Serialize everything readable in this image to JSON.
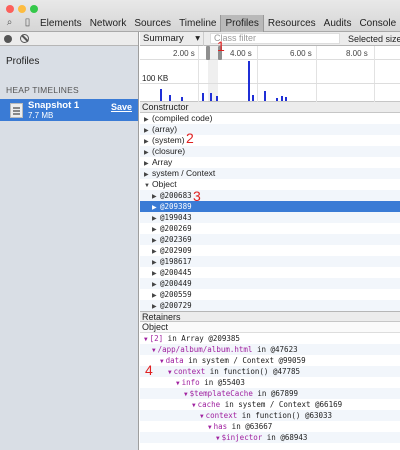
{
  "window": {
    "lights": [
      "#fc605b",
      "#fdbc40",
      "#34c84a"
    ]
  },
  "tabs": [
    "Elements",
    "Network",
    "Sources",
    "Timeline",
    "Profiles",
    "Resources",
    "Audits",
    "Console"
  ],
  "active_tab": "Profiles",
  "sidebar": {
    "title": "Profiles",
    "section": "HEAP TIMELINES",
    "snapshot": {
      "title": "Snapshot 1",
      "size": "7.7 MB",
      "save": "Save"
    }
  },
  "toolbar": {
    "view": "Summary",
    "filter_placeholder": "Class filter",
    "selected": "Selected size"
  },
  "timeline": {
    "ticks": [
      "2.00 s",
      "4.00 s",
      "6.00 s",
      "8.00 s"
    ],
    "scale_label": "100 KB"
  },
  "constructor_header": "Constructor",
  "constructors": [
    {
      "label": "(compiled code)",
      "open": false
    },
    {
      "label": "(array)",
      "open": false
    },
    {
      "label": "(system)",
      "open": false
    },
    {
      "label": "(closure)",
      "open": false
    },
    {
      "label": "Array",
      "open": false
    },
    {
      "label": "system / Context",
      "open": false
    },
    {
      "label": "Object",
      "open": true
    }
  ],
  "objects": [
    "@200683",
    "@209389",
    "@199043",
    "@200269",
    "@202369",
    "@202909",
    "@198617",
    "@200445",
    "@200449",
    "@200559",
    "@200729"
  ],
  "selected_object": "@209389",
  "retainers_header": "Retainers",
  "object_header": "Object",
  "retainers": [
    {
      "name": "[2]",
      "rest": " in Array @209385"
    },
    {
      "name": "/app/album/album.html",
      "rest": " in @47623"
    },
    {
      "name": "data",
      "rest": " in system / Context @99059"
    },
    {
      "name": "context",
      "rest": " in function() @47785"
    },
    {
      "name": "info",
      "rest": " in @55403"
    },
    {
      "name": "$templateCache",
      "rest": " in @67899"
    },
    {
      "name": "cache",
      "rest": " in system / Context @66169"
    },
    {
      "name": "context",
      "rest": " in function() @63033"
    },
    {
      "name": "has",
      "rest": " in @63667"
    },
    {
      "name": "$injector",
      "rest": " in @68943"
    }
  ],
  "annotations": [
    "1",
    "2",
    "3",
    "4"
  ]
}
